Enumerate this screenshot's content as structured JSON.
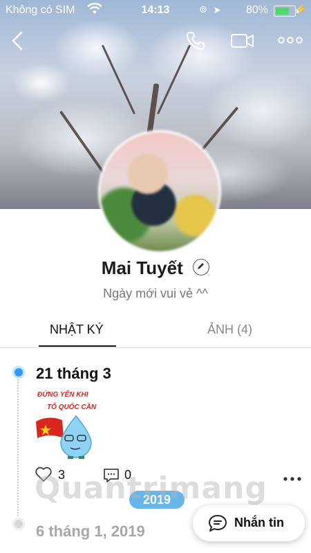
{
  "status_bar": {
    "carrier": "Không có SIM",
    "time": "14:13",
    "battery_percent": "80%",
    "battery_level": 0.8
  },
  "profile": {
    "name": "Mai Tuyết",
    "status_message": "Ngày mới vui vẻ ^^"
  },
  "tabs": [
    {
      "label": "NHẬT KÝ",
      "active": true
    },
    {
      "label": "ẢNH (4)",
      "active": false
    }
  ],
  "posts": [
    {
      "date": "21 tháng 3",
      "sticker_text_line1": "ĐỨNG YÊN KHI",
      "sticker_text_line2": "TỔ QUỐC CẦN",
      "likes": "3",
      "comments": "0"
    },
    {
      "date": "6 tháng 1, 2019"
    }
  ],
  "year_badge": "2019",
  "message_button": {
    "label": "Nhắn tin"
  },
  "watermark": "Quantrimang",
  "colors": {
    "accent": "#2f9ef2",
    "year_badge": "#66b6ec",
    "battery": "#4cd964"
  }
}
